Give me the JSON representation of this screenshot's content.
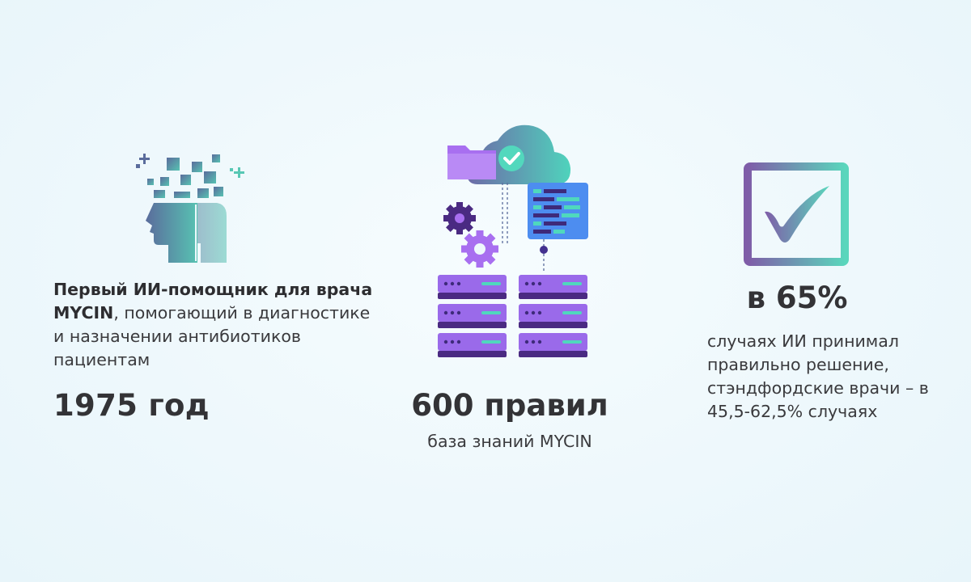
{
  "left": {
    "icon": "ai-head-icon",
    "desc_bold": "Первый ИИ-помощник для врача MYCIN",
    "desc_rest": ", помогающий в диагностике и назначении антибиотиков пациентам",
    "year": "1975 год"
  },
  "middle": {
    "icon": "cloud-server-icon",
    "value": "600 правил",
    "caption": "база знаний MYCIN"
  },
  "right": {
    "icon": "checkmark-icon",
    "value": "в 65%",
    "desc": "случаях ИИ принимал правильно решение, стэндфордские врачи – в 45,5-62,5% случаях"
  },
  "colors": {
    "text": "#333336",
    "purple": "#8e4fe0",
    "dark_purple": "#43308f",
    "teal": "#4fd8bd",
    "slate": "#57709a"
  }
}
